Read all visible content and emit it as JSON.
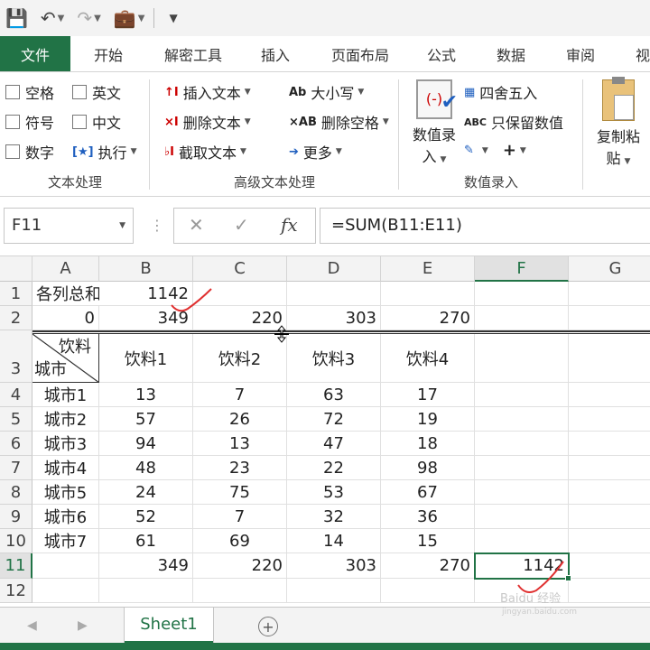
{
  "qat": {
    "icons": [
      "save-icon",
      "undo-icon",
      "redo-icon",
      "briefcase-icon",
      "customize-icon"
    ]
  },
  "tabs": [
    "文件",
    "开始",
    "解密工具",
    "插入",
    "页面布局",
    "公式",
    "数据",
    "审阅",
    "视"
  ],
  "ribbon": {
    "text_group": {
      "label": "文本处理",
      "items": [
        "空格",
        "英文",
        "符号",
        "中文",
        "数字",
        "执行"
      ]
    },
    "adv_group": {
      "label": "高级文本处理",
      "items": [
        "插入文本",
        "删除文本",
        "截取文本",
        "大小写",
        "删除空格",
        "更多"
      ]
    },
    "num_group": {
      "label": "数值录入",
      "big": [
        "数值录",
        "入"
      ],
      "items": [
        "四舍五入",
        "只保留数值",
        "+"
      ]
    },
    "paste_group": {
      "big": [
        "复制粘",
        "贴"
      ]
    }
  },
  "formula_bar": {
    "name_box": "F11",
    "fx": "fx",
    "formula": "=SUM(B11:E11)"
  },
  "grid": {
    "columns": [
      "A",
      "B",
      "C",
      "D",
      "E",
      "F",
      "G"
    ],
    "rows": [
      "1",
      "2",
      "3",
      "4",
      "5",
      "6",
      "7",
      "8",
      "9",
      "10",
      "11",
      "12"
    ],
    "r1": {
      "a": "各列总和",
      "b": "1142"
    },
    "r2": [
      "0",
      "349",
      "220",
      "303",
      "270"
    ],
    "header": {
      "diag_top": "饮料",
      "diag_bottom": "城市",
      "b": "饮料1",
      "c": "饮料2",
      "d": "饮料3",
      "e": "饮料4"
    },
    "data": [
      [
        "城市1",
        "13",
        "7",
        "63",
        "17"
      ],
      [
        "城市2",
        "57",
        "26",
        "72",
        "19"
      ],
      [
        "城市3",
        "94",
        "13",
        "47",
        "18"
      ],
      [
        "城市4",
        "48",
        "23",
        "22",
        "98"
      ],
      [
        "城市5",
        "24",
        "75",
        "53",
        "67"
      ],
      [
        "城市6",
        "52",
        "7",
        "32",
        "36"
      ],
      [
        "城市7",
        "61",
        "69",
        "14",
        "15"
      ]
    ],
    "r11": [
      "349",
      "220",
      "303",
      "270",
      "1142"
    ]
  },
  "sheets": {
    "active": "Sheet1"
  },
  "watermark": {
    "line1": "Baidu 经验",
    "line2": "jingyan.baidu.com"
  }
}
